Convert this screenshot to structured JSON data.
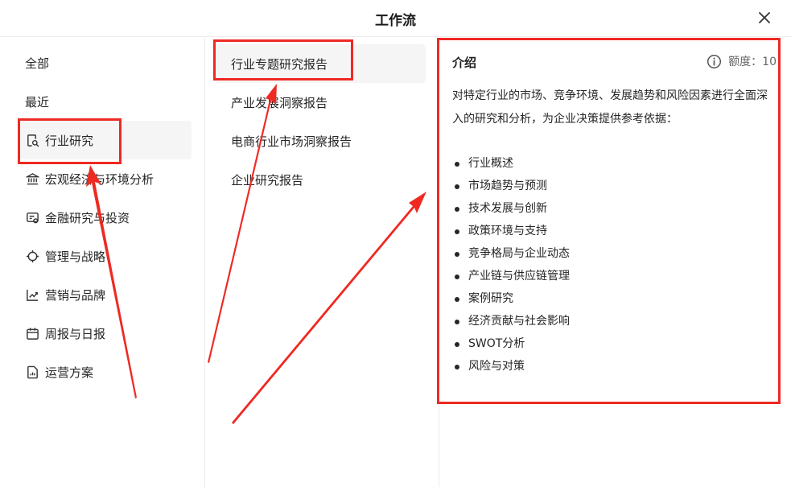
{
  "header": {
    "title": "工作流"
  },
  "categories": [
    {
      "label": "全部",
      "icon": ""
    },
    {
      "label": "最近",
      "icon": ""
    },
    {
      "label": "行业研究",
      "icon": "doc-search-icon",
      "active": true
    },
    {
      "label": "宏观经济与环境分析",
      "icon": "bank-icon"
    },
    {
      "label": "金融研究与投资",
      "icon": "finance-icon"
    },
    {
      "label": "管理与战略",
      "icon": "target-icon"
    },
    {
      "label": "营销与品牌",
      "icon": "trend-chart-icon"
    },
    {
      "label": "周报与日报",
      "icon": "calendar-icon"
    },
    {
      "label": "运营方案",
      "icon": "report-icon"
    }
  ],
  "subcategories": [
    {
      "label": "行业专题研究报告",
      "active": true
    },
    {
      "label": "产业发展洞察报告"
    },
    {
      "label": "电商行业市场洞察报告"
    },
    {
      "label": "企业研究报告"
    }
  ],
  "intro": {
    "title": "介绍",
    "quota_label": "额度：10",
    "description": "对特定行业的市场、竞争环境、发展趋势和风险因素进行全面深入的研究和分析，为企业决策提供参考依据：",
    "items": [
      "行业概述",
      "市场趋势与预测",
      "技术发展与创新",
      "政策环境与支持",
      "竞争格局与企业动态",
      "产业链与供应链管理",
      "案例研究",
      "经济贡献与社会影响",
      "SWOT分析",
      "风险与对策"
    ]
  },
  "colors": {
    "highlight": "#ee2a23",
    "active_bg": "#f5f5f5"
  }
}
